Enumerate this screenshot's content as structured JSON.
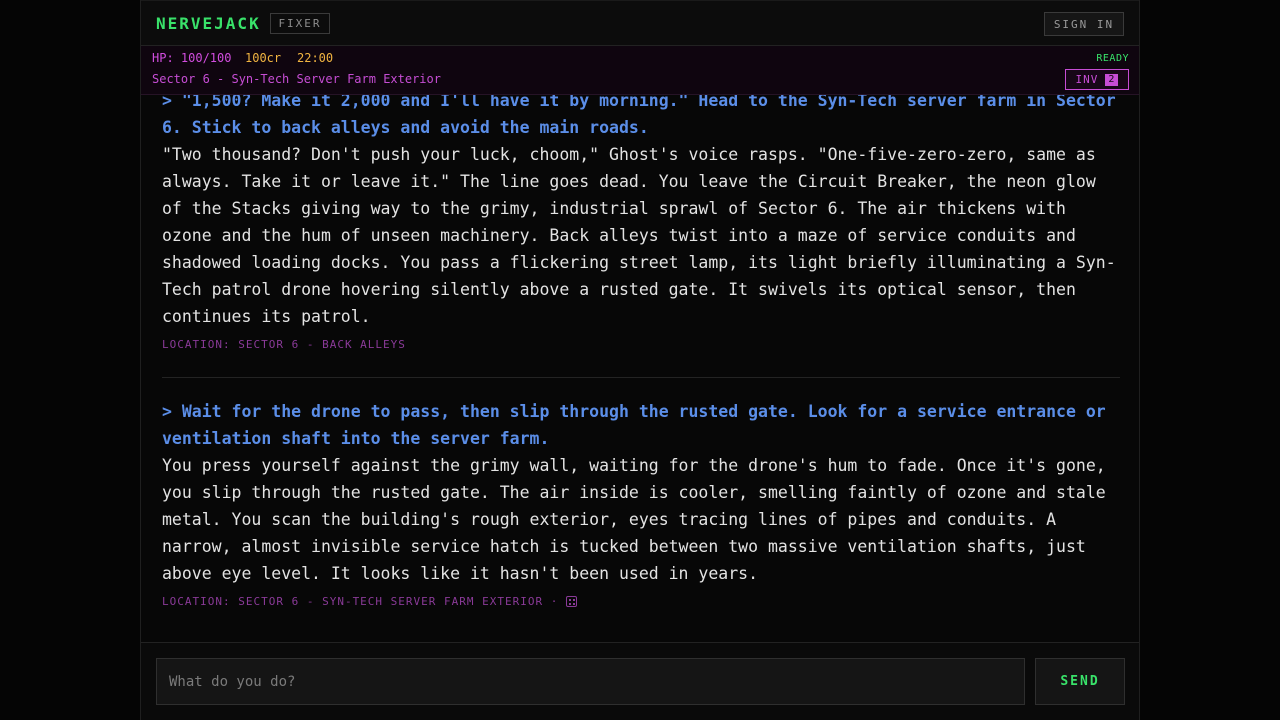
{
  "header": {
    "brand": "NERVEJACK",
    "role": "FIXER",
    "signin_label": "SIGN IN"
  },
  "status": {
    "hp": "HP: 100/100",
    "credits": "100cr",
    "time": "22:00",
    "ready": "READY",
    "location": "Sector 6 - Syn-Tech Server Farm Exterior",
    "inventory_label": "INV",
    "inventory_count": "2"
  },
  "log": {
    "entries": [
      {
        "command": "> \"1,500? Make it 2,000 and I'll have it by morning.\" Head to the Syn-Tech server farm in Sector 6. Stick to back alleys and avoid the main roads.",
        "narration": "\"Two thousand? Don't push your luck, choom,\" Ghost's voice rasps. \"One-five-zero-zero, same as always. Take it or leave it.\" The line goes dead. You leave the Circuit Breaker, the neon glow of the Stacks giving way to the grimy, industrial sprawl of Sector 6. The air thickens with ozone and the hum of unseen machinery. Back alleys twist into a maze of service conduits and shadowed loading docks. You pass a flickering street lamp, its light briefly illuminating a Syn-Tech patrol drone hovering silently above a rusted gate. It swivels its optical sensor, then continues its patrol.",
        "location": "LOCATION: SECTOR 6 - BACK ALLEYS"
      },
      {
        "command": "> Wait for the drone to pass, then slip through the rusted gate. Look for a service entrance or ventilation shaft into the server farm.",
        "narration": "You press yourself against the grimy wall, waiting for the drone's hum to fade. Once it's gone, you slip through the rusted gate. The air inside is cooler, smelling faintly of ozone and stale metal. You scan the building's rough exterior, eyes tracing lines of pipes and conduits. A narrow, almost invisible service hatch is tucked between two massive ventilation shafts, just above eye level. It looks like it hasn't been used in years.",
        "location": "LOCATION: SECTOR 6 - SYN-TECH SERVER FARM EXTERIOR ·"
      }
    ]
  },
  "composer": {
    "placeholder": "What do you do?",
    "send_label": "SEND"
  }
}
